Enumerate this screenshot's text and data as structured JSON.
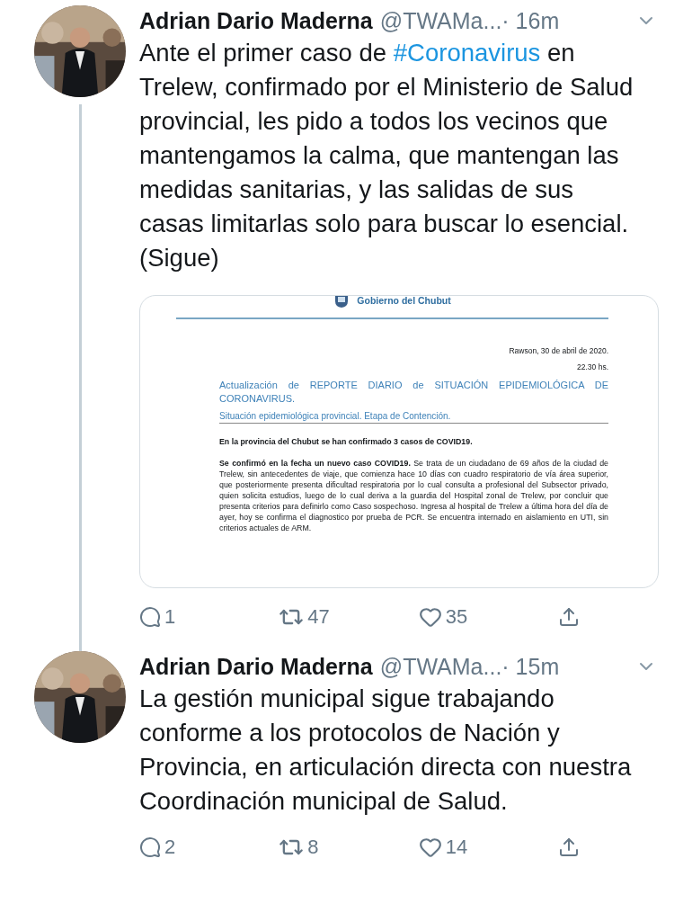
{
  "tweets": [
    {
      "author": "Adrian Dario Maderna",
      "handle": "@TWAMa...",
      "time": "· 16m",
      "paragraphs": [
        [
          {
            "kind": "text",
            "text": "Ante el primer caso de "
          },
          {
            "kind": "hashtag",
            "text": "#Coronavirus"
          },
          {
            "kind": "text",
            "text": " en Trelew, confirmado por el Ministerio de Salud provincial, les pido a todos los vecinos que mantengamos la calma, que mantengan las medidas sanitarias, y las salidas de sus casas limitarlas solo para buscar lo esencial."
          }
        ],
        [
          {
            "kind": "text",
            "text": "(Sigue)"
          }
        ]
      ],
      "document": {
        "org": "Gobierno del Chubut",
        "place_date": "Rawson, 30 de abril de 2020.",
        "hour": "22.30 hs.",
        "title": "Actualización de REPORTE DIARIO de SITUACIÓN EPIDEMIOLÓGICA DE CORONAVIRUS.",
        "subtitle": "Situación epidemiológica provincial. Etapa de Contención.",
        "paragraphs": [
          {
            "kind": "bold",
            "text": "En la provincia del Chubut se han confirmado 3 casos  de COVID19."
          },
          {
            "kind": "plain",
            "text": "**Se confirmó en la fecha un nuevo caso COVID19.** Se trata de un ciudadano de 69 años de la ciudad de Trelew, sin antecedentes de viaje, que comienza hace 10 días con cuadro respiratorio de vía área superior, que posteriormente presenta dificultad respiratoria por lo cual consulta  a profesional del Subsector privado, quien solicita estudios, luego de lo cual deriva a la guardia del Hospital zonal de Trelew, por concluir que presenta criterios para definirlo como Caso sospechoso. Ingresa al hospital de Trelew a última hora del día de ayer, hoy se confirma el diagnostico por prueba de PCR.  Se encuentra internado en aislamiento en UTI,  sin criterios actuales  de ARM."
          }
        ]
      },
      "replies": "1",
      "retweets": "47",
      "likes": "35",
      "thread": true
    },
    {
      "author": "Adrian Dario Maderna",
      "handle": "@TWAMa...",
      "time": "· 15m",
      "paragraphs": [
        [
          {
            "kind": "text",
            "text": "La gestión municipal sigue trabajando conforme a los protocolos de Nación y Provincia, en articulación directa con nuestra Coordinación municipal de Salud."
          }
        ]
      ],
      "replies": "2",
      "retweets": "8",
      "likes": "14",
      "thread": false
    }
  ]
}
